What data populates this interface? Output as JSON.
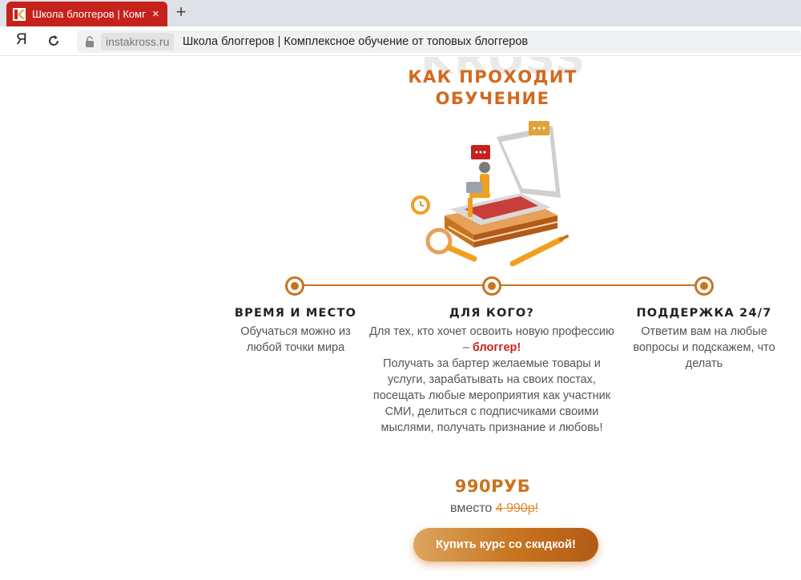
{
  "browser": {
    "tab_title": "Школа блоггеров | Комп",
    "tab_close": "×",
    "new_tab": "+",
    "yandex_button": "Я",
    "domain": "instakross.ru",
    "page_title": "Школа блоггеров | Комплексное обучение от топовых блоггеров",
    "brand_color": "#c5221b"
  },
  "page": {
    "watermark": "KROSS",
    "section_title": "Как проходит обучение",
    "accent_color": "#c8741f",
    "timeline": [
      {
        "title": "Время и место",
        "text": "Обучаться можно из любой точки мира"
      },
      {
        "title": "Для кого?",
        "text_before": "Для тех, кто хочет освоить новую профессию – ",
        "highlight": "блоггер!",
        "text_after": "Получать за бартер желаемые товары и услуги, зарабатывать на своих постах, посещать любые мероприятия как участник СМИ, делиться с подписчиками своими мыслями, получать признание и любовь!"
      },
      {
        "title": "Поддержка 24/7",
        "text": "Ответим вам на любые вопросы и подскажем, что делать"
      }
    ],
    "price": "990РУБ",
    "instead_label": "вместо",
    "old_price": "4 990р!",
    "cta_label": "Купить курс со скидкой!"
  }
}
